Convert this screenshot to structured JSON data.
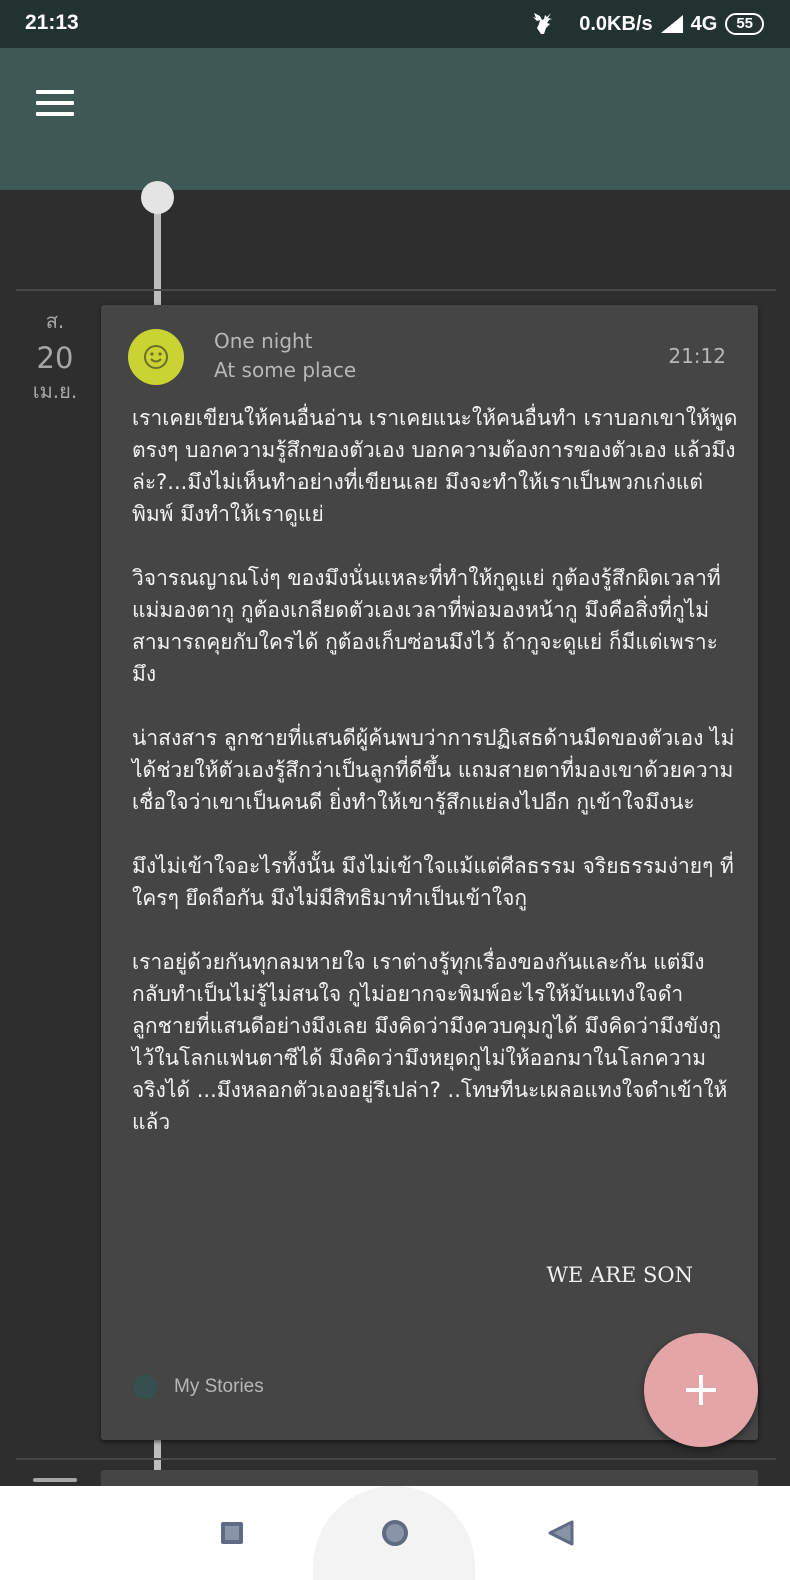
{
  "status_bar": {
    "time": "21:13",
    "network_speed": "0.0KB/s",
    "network_type": "4G",
    "battery": "55",
    "icons": [
      "deer-icon",
      "signal-icon"
    ]
  },
  "appbar": {
    "menu_icon": "hamburger-menu-icon",
    "background_color": "#3e5856"
  },
  "entry": {
    "date": {
      "day_of_week": "ส.",
      "day": "20",
      "month": "เม.ย."
    },
    "mood_icon": "smiley-face-icon",
    "mood_color": "#c9d433",
    "title": "One night",
    "place": "At some place",
    "time": "21:12",
    "paragraphs": [
      "เราเคยเขียนให้คนอื่นอ่าน เราเคยแนะให้คนอื่นทำ เราบอกเขาให้พูดตรงๆ บอกความรู้สึกของตัวเอง บอกความต้องการของตัวเอง แล้วมึงล่ะ?...มึงไม่เห็นทำอย่างที่เขียนเลย มึงจะทำให้เราเป็นพวกเก่งแต่พิมพ์ มึงทำให้เราดูแย่",
      "วิจารณญาณโง่ๆ ของมึงนั่นแหละที่ทำให้กูดูแย่ กูต้องรู้สึกผิดเวลาที่แม่มองตากู กูต้องเกลียดตัวเองเวลาที่พ่อมองหน้ากู  มึงคือสิ่งที่กูไม่สามารถคุยกับใครได้ กูต้องเก็บซ่อนมึงไว้ ถ้ากูจะดูแย่ ก็มีแต่เพราะมึง",
      "น่าสงสาร ลูกชายที่แสนดีผู้ค้นพบว่าการปฏิเสธด้านมืดของตัวเอง ไม่ได้ช่วยให้ตัวเองรู้สึกว่าเป็นลูกที่ดีขึ้น แถมสายตาที่มองเขาด้วยความเชื่อใจว่าเขาเป็นคนดี ยิ่งทำให้เขารู้สึกแย่ลงไปอีก กูเข้าใจมึงนะ",
      "มึงไม่เข้าใจอะไรทั้งนั้น มึงไม่เข้าใจแม้แต่ศีลธรรม จริยธรรมง่ายๆ ที่ใครๆ ยึดถือกัน มึงไม่มีสิทธิมาทำเป็นเข้าใจกู",
      "เราอยู่ด้วยกันทุกลมหายใจ เราต่างรู้ทุกเรื่องของกันและกัน แต่มึงกลับทำเป็นไม่รู้ไม่สนใจ กูไม่อยากจะพิมพ์อะไรให้มันแทงใจดำลูกชายที่แสนดีอย่างมึงเลย มึงคิดว่ามึงควบคุมกูได้ มึงคิดว่ามึงขังกูไว้ในโลกแฟนตาซีได้ มึงคิดว่ามึงหยุดกูไม่ให้ออกมาในโลกความจริงได้ ...มึงหลอกตัวเองอยู่รึเปล่า? ..โทษทีนะเผลอแทงใจดำเข้าให้แล้ว"
    ],
    "signature": "WE ARE SON",
    "tag": {
      "label": "My Stories",
      "color": "#35504e"
    }
  },
  "fab": {
    "icon": "plus-icon",
    "color": "#e3a5a8"
  },
  "navbar": {
    "icons": [
      "recents-square-icon",
      "home-circle-icon",
      "back-triangle-icon"
    ]
  }
}
